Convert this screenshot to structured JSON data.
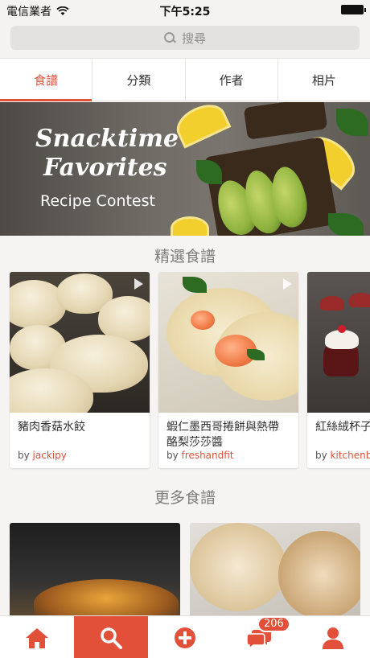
{
  "status_bar": {
    "carrier": "電信業者",
    "time": "下午5:25"
  },
  "search": {
    "placeholder": "搜尋"
  },
  "tabs": [
    {
      "label": "食譜",
      "active": true
    },
    {
      "label": "分類",
      "active": false
    },
    {
      "label": "作者",
      "active": false
    },
    {
      "label": "相片",
      "active": false
    }
  ],
  "banner": {
    "line1": "Snacktime",
    "line2": "Favorites",
    "line3": "Recipe Contest"
  },
  "featured": {
    "title": "精選食譜",
    "cards": [
      {
        "title": "豬肉香菇水餃",
        "by": "by",
        "author": "jackipy",
        "video": true
      },
      {
        "title": "蝦仁墨西哥捲餅與熱帶",
        "title2": "酪梨莎莎醬",
        "by": "by",
        "author": "freshandfit",
        "video": true
      },
      {
        "title": "紅絲絨杯子",
        "by": "by",
        "author": "kitchenbo",
        "video": false
      }
    ]
  },
  "more": {
    "title": "更多食譜"
  },
  "bottom_nav": {
    "items": [
      {
        "name": "home",
        "active": false
      },
      {
        "name": "search",
        "active": true
      },
      {
        "name": "add",
        "active": false
      },
      {
        "name": "messages",
        "active": false,
        "badge": "206"
      },
      {
        "name": "profile",
        "active": false
      }
    ]
  },
  "colors": {
    "accent": "#e2503a",
    "background": "#f5f4f2"
  }
}
